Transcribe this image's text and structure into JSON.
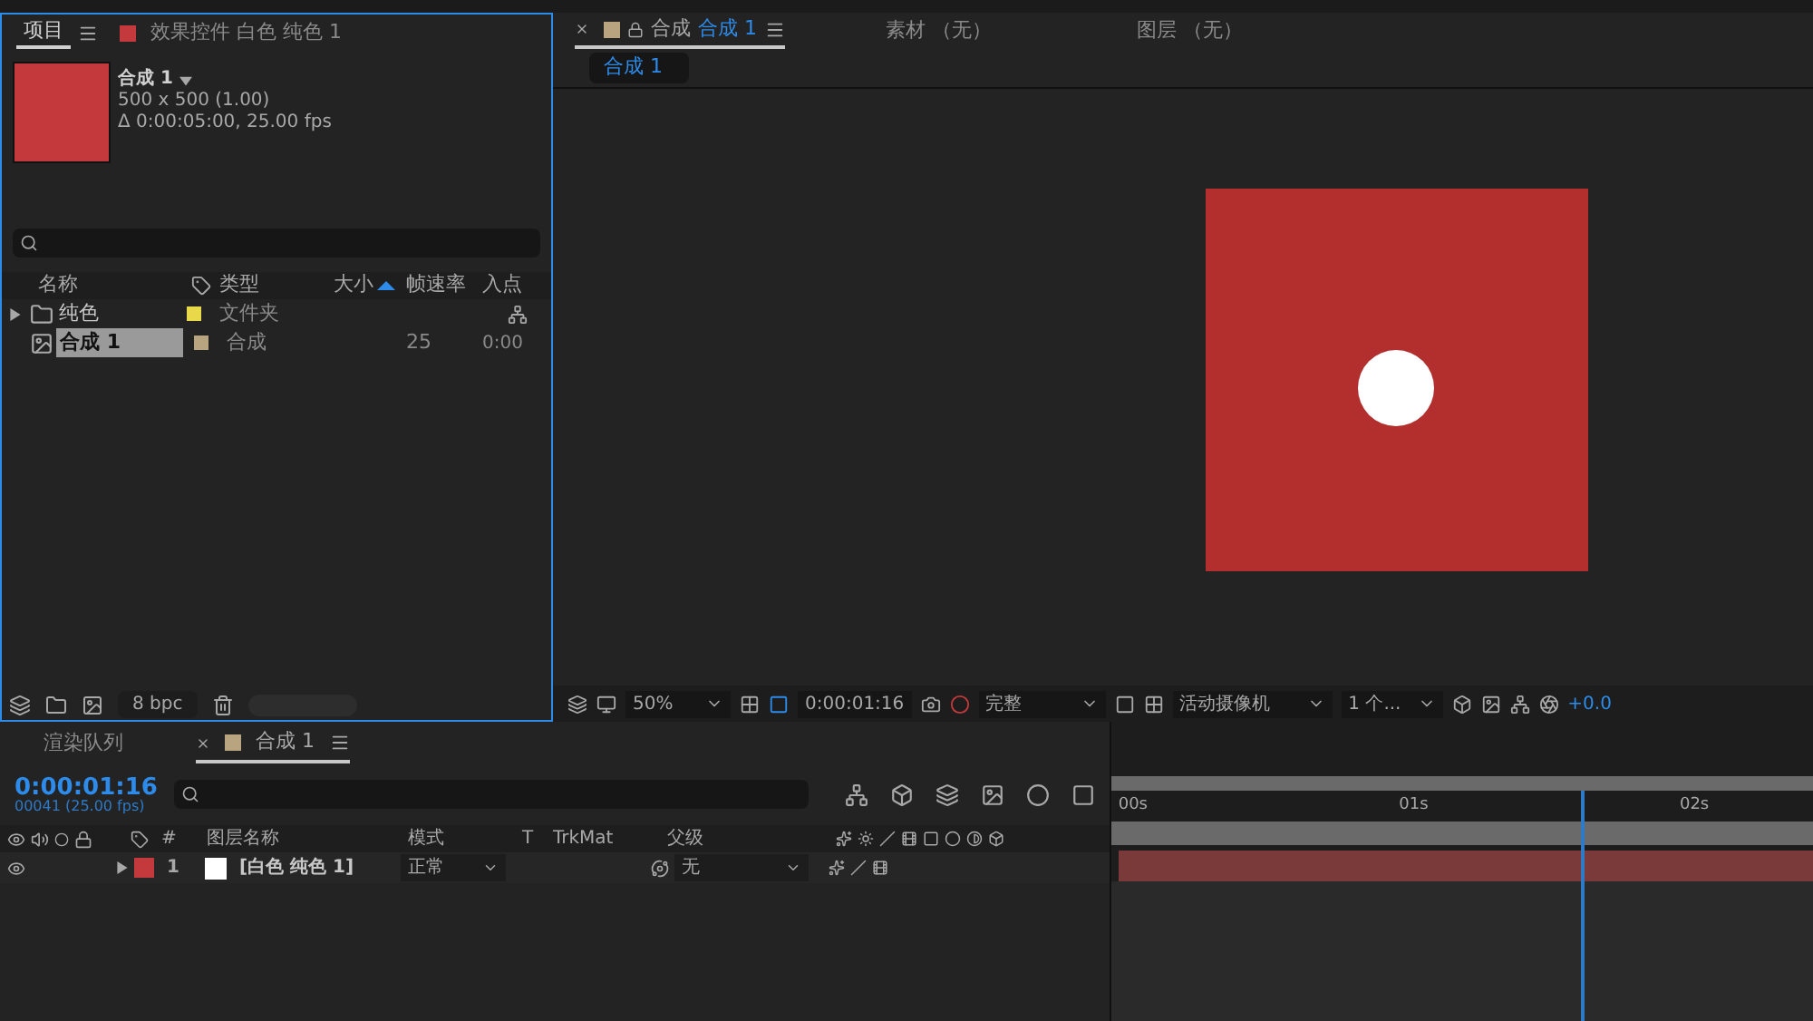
{
  "project_panel": {
    "tabs": [
      {
        "label": "项目",
        "selected": true
      },
      {
        "label": "效果控件 白色 纯色 1",
        "selected": false
      }
    ],
    "info": {
      "name": "合成 1",
      "dimensions": "500 x 500 (1.00)",
      "duration": "Δ 0:00:05:00, 25.00 fps"
    },
    "columns": [
      "名称",
      "类型",
      "大小",
      "帧速率",
      "入点"
    ],
    "items": [
      {
        "kind": "folder",
        "name": "纯色",
        "color": "#e8d84a",
        "type": "文件夹",
        "selected": false
      },
      {
        "kind": "composition",
        "name": "合成 1",
        "color": "#b8a47e",
        "type": "合成",
        "frame_rate": "25",
        "in_point": "0:00",
        "selected": true
      }
    ],
    "bit_depth": "8 bpc"
  },
  "viewer": {
    "tabs": [
      {
        "prefix": "合成",
        "label": "合成 1",
        "selected": true
      },
      {
        "label": "素材 （无）",
        "selected": false
      },
      {
        "label": "图层 （无）",
        "selected": false
      }
    ],
    "breadcrumb": "合成 1",
    "toolbar": {
      "zoom": "50%",
      "time": "0:00:01:16",
      "resolution": "完整",
      "camera": "活动摄像机",
      "views": "1 个...",
      "exposure": "+0.0"
    }
  },
  "timeline": {
    "tabs": [
      {
        "label": "渲染队列",
        "selected": false
      },
      {
        "label": "合成 1",
        "selected": true
      }
    ],
    "current_time": "0:00:01:16",
    "frame_info": "00041 (25.00 fps)",
    "columns": [
      "#",
      "图层名称",
      "模式",
      "T",
      "TrkMat",
      "父级"
    ],
    "layers": [
      {
        "number": "1",
        "name": "[白色 纯色 1]",
        "color": "#c4393b",
        "mode": "正常",
        "parent": "无"
      }
    ],
    "ruler": [
      "00s",
      "01s",
      "02s"
    ],
    "playhead": {
      "level": 0.67
    }
  }
}
